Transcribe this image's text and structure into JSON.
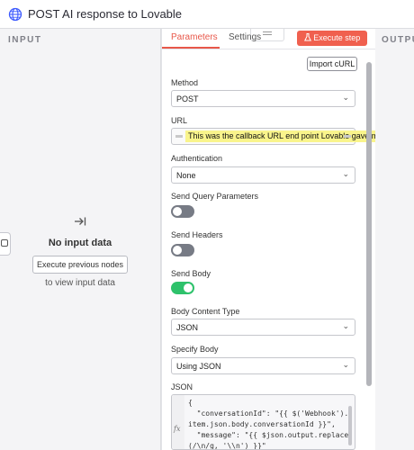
{
  "window": {
    "title": "POST AI response to Lovable",
    "icon": "globe-icon"
  },
  "input_panel": {
    "label": "INPUT",
    "empty_icon": "arrow-to-right-icon",
    "empty_title": "No input data",
    "execute_prev_label": "Execute previous nodes",
    "hint": "to view input data"
  },
  "tabs": {
    "parameters": "Parameters",
    "settings": "Settings",
    "active": "Parameters"
  },
  "execute_step": {
    "label": "Execute step",
    "icon": "flask-icon",
    "color": "#f0604f"
  },
  "import_curl": "Import cURL",
  "fields": {
    "method": {
      "label": "Method",
      "value": "POST"
    },
    "url": {
      "label": "URL",
      "value": "This was the callback URL end point Lovable gave me"
    },
    "authentication": {
      "label": "Authentication",
      "value": "None"
    },
    "send_query": {
      "label": "Send Query Parameters",
      "on": false
    },
    "send_headers": {
      "label": "Send Headers",
      "on": false
    },
    "send_body": {
      "label": "Send Body",
      "on": true
    },
    "body_content_type": {
      "label": "Body Content Type",
      "value": "JSON"
    },
    "specify_body": {
      "label": "Specify Body",
      "value": "Using JSON"
    },
    "json": {
      "label": "JSON",
      "gutter": "fx",
      "lines": [
        "{",
        "  \"conversationId\": \"{{ $('Webhook').",
        "item.json.body.conversationId }}\",",
        "  \"message\": \"{{ $json.output.replace",
        "(/\\n/g, '\\\\n') }}\""
      ]
    }
  },
  "output_panel": {
    "label": "OUTPUT"
  },
  "colors": {
    "accent": "#e8584a",
    "toggle_on": "#2ec26b",
    "toggle_off": "#777b85",
    "highlight": "#f9f48c"
  }
}
